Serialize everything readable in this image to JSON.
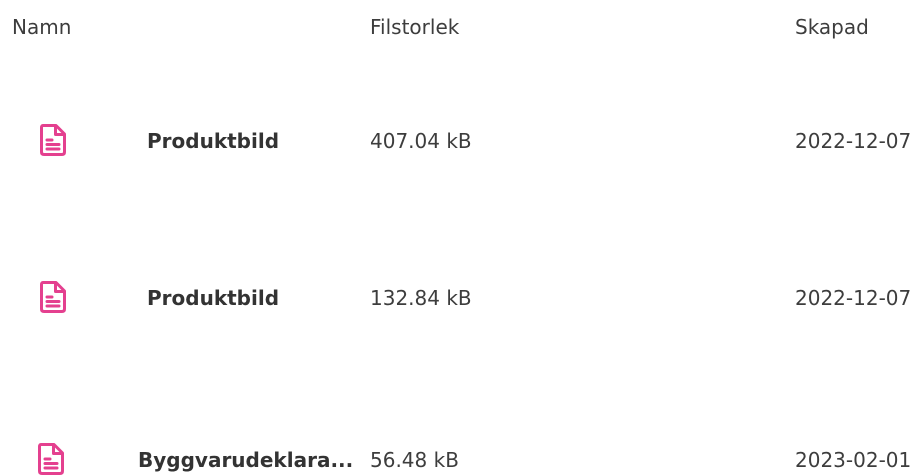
{
  "table": {
    "headers": {
      "name": "Namn",
      "size": "Filstorlek",
      "created": "Skapad"
    },
    "rows": [
      {
        "icon": "document-icon",
        "name": "Produktbild",
        "size": "407.04 kB",
        "created": "2022-12-07"
      },
      {
        "icon": "document-icon",
        "name": "Produktbild",
        "size": "132.84 kB",
        "created": "2022-12-07"
      },
      {
        "icon": "document-icon",
        "name": "Byggvarudeklara...",
        "size": "56.48 kB",
        "created": "2023-02-01"
      }
    ]
  },
  "colors": {
    "icon_accent": "#e4408f",
    "text": "#3d3d3d"
  }
}
